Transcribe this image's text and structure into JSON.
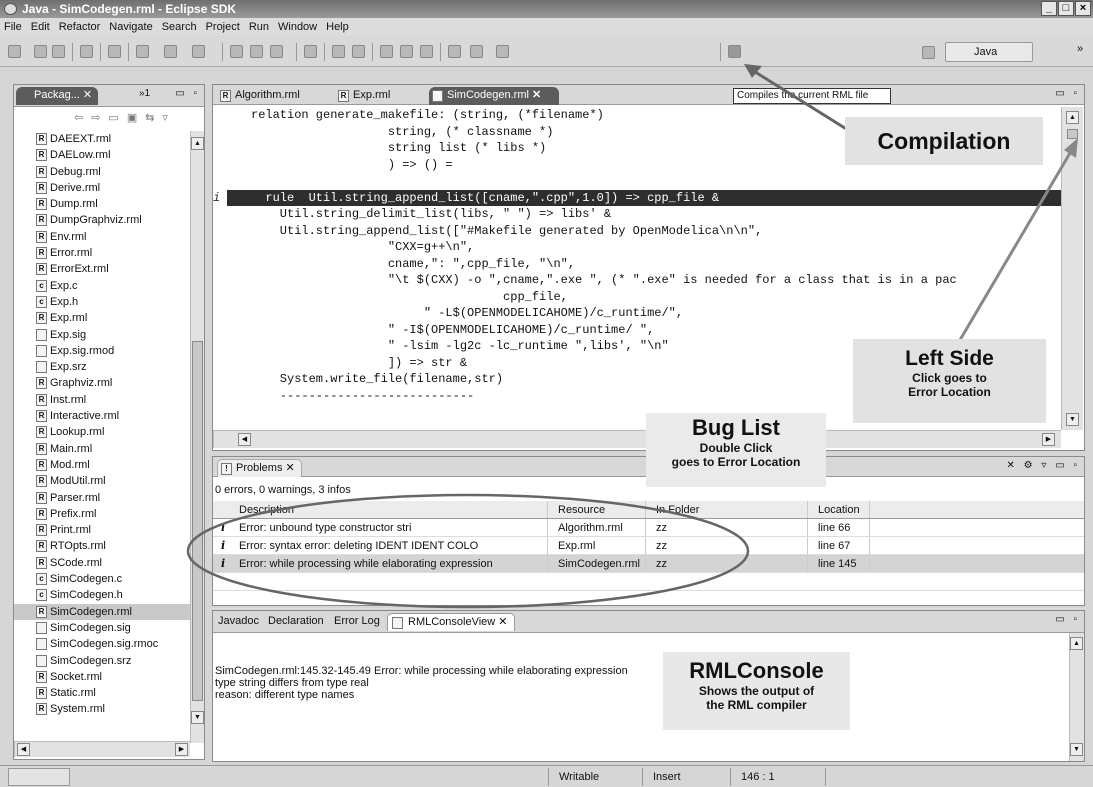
{
  "window": {
    "title": "Java - SimCodegen.rml - Eclipse SDK"
  },
  "menu": [
    "File",
    "Edit",
    "Refactor",
    "Navigate",
    "Search",
    "Project",
    "Run",
    "Window",
    "Help"
  ],
  "toolbar": {
    "perspective": "Java",
    "tooltip": "Compiles the current RML file"
  },
  "package_explorer": {
    "tab_label": "Packag...",
    "tab_overflow": "»1",
    "files": [
      {
        "name": "DAEEXT.rml",
        "type": "R"
      },
      {
        "name": "DAELow.rml",
        "type": "R"
      },
      {
        "name": "Debug.rml",
        "type": "R"
      },
      {
        "name": "Derive.rml",
        "type": "R"
      },
      {
        "name": "Dump.rml",
        "type": "R"
      },
      {
        "name": "DumpGraphviz.rml",
        "type": "R"
      },
      {
        "name": "Env.rml",
        "type": "R"
      },
      {
        "name": "Error.rml",
        "type": "R"
      },
      {
        "name": "ErrorExt.rml",
        "type": "R"
      },
      {
        "name": "Exp.c",
        "type": "c"
      },
      {
        "name": "Exp.h",
        "type": "c"
      },
      {
        "name": "Exp.rml",
        "type": "R"
      },
      {
        "name": "Exp.sig",
        "type": "f"
      },
      {
        "name": "Exp.sig.rmod",
        "type": "f"
      },
      {
        "name": "Exp.srz",
        "type": "f"
      },
      {
        "name": "Graphviz.rml",
        "type": "R"
      },
      {
        "name": "Inst.rml",
        "type": "R"
      },
      {
        "name": "Interactive.rml",
        "type": "R"
      },
      {
        "name": "Lookup.rml",
        "type": "R"
      },
      {
        "name": "Main.rml",
        "type": "R"
      },
      {
        "name": "Mod.rml",
        "type": "R"
      },
      {
        "name": "ModUtil.rml",
        "type": "R"
      },
      {
        "name": "Parser.rml",
        "type": "R"
      },
      {
        "name": "Prefix.rml",
        "type": "R"
      },
      {
        "name": "Print.rml",
        "type": "R"
      },
      {
        "name": "RTOpts.rml",
        "type": "R"
      },
      {
        "name": "SCode.rml",
        "type": "R"
      },
      {
        "name": "SimCodegen.c",
        "type": "c"
      },
      {
        "name": "SimCodegen.h",
        "type": "c"
      },
      {
        "name": "SimCodegen.rml",
        "type": "R",
        "selected": true
      },
      {
        "name": "SimCodegen.sig",
        "type": "f"
      },
      {
        "name": "SimCodegen.sig.rmoc",
        "type": "f"
      },
      {
        "name": "SimCodegen.srz",
        "type": "f"
      },
      {
        "name": "Socket.rml",
        "type": "R"
      },
      {
        "name": "Static.rml",
        "type": "R"
      },
      {
        "name": "System.rml",
        "type": "R"
      }
    ]
  },
  "editor": {
    "tabs": [
      {
        "label": "Algorithm.rml"
      },
      {
        "label": "Exp.rml"
      },
      {
        "label": "SimCodegen.rml",
        "active": true
      }
    ],
    "lines": [
      {
        "text": "relation generate_makefile: (string, (*filename*)",
        "marker": ""
      },
      {
        "text": "                   string, (* classname *)",
        "marker": ""
      },
      {
        "text": "                   string list (* libs *)",
        "marker": ""
      },
      {
        "text": "                   ) => () =",
        "marker": ""
      },
      {
        "text": "",
        "marker": ""
      },
      {
        "text": "  rule  Util.string_append_list([cname,\".cpp\",1.0]) => cpp_file &",
        "marker": "i",
        "highlight": true
      },
      {
        "text": "    Util.string_delimit_list(libs, \" \") => libs' &",
        "marker": ""
      },
      {
        "text": "    Util.string_append_list([\"#Makefile generated by OpenModelica\\n\\n\",",
        "marker": ""
      },
      {
        "text": "                   \"CXX=g++\\n\",",
        "marker": ""
      },
      {
        "text": "                   cname,\": \",cpp_file, \"\\n\",",
        "marker": ""
      },
      {
        "text": "                   \"\\t $(CXX) -o \",cname,\".exe \", (* \".exe\" is needed for a class that is in a pac",
        "marker": ""
      },
      {
        "text": "                                   cpp_file,",
        "marker": ""
      },
      {
        "text": "                        \" -L$(OPENMODELICAHOME)/c_runtime/\",",
        "marker": ""
      },
      {
        "text": "                   \" -I$(OPENMODELICAHOME)/c_runtime/ \",",
        "marker": ""
      },
      {
        "text": "                   \" -lsim -lg2c -lc_runtime \",libs', \"\\n\"",
        "marker": ""
      },
      {
        "text": "                   ]) => str &",
        "marker": ""
      },
      {
        "text": "    System.write_file(filename,str)",
        "marker": ""
      },
      {
        "text": "    ---------------------------",
        "marker": ""
      }
    ]
  },
  "problems": {
    "tab_label": "Problems",
    "summary": "0 errors, 0 warnings, 3 infos",
    "columns": [
      "Description",
      "Resource",
      "In Folder",
      "Location"
    ],
    "rows": [
      {
        "description": "Error: unbound type constructor stri",
        "resource": "Algorithm.rml",
        "folder": "zz",
        "location": "line 66"
      },
      {
        "description": "Error: syntax error: deleting  IDENT IDENT COLO",
        "resource": "Exp.rml",
        "folder": "zz",
        "location": "line 67"
      },
      {
        "description": "Error: while processing while elaborating expression",
        "resource": "SimCodegen.rml",
        "folder": "zz",
        "location": "line 145"
      }
    ]
  },
  "console": {
    "tabs": [
      {
        "label": "Javadoc"
      },
      {
        "label": "Declaration"
      },
      {
        "label": "Error Log"
      },
      {
        "label": "RMLConsoleView",
        "active": true
      }
    ],
    "lines": [
      "SimCodegen.rml:145.32-145.49 Error: while processing while elaborating expression",
      "type string differs from type real",
      "reason: different type names"
    ]
  },
  "annotations": {
    "compilation": "Compilation",
    "left_side_title": "Left Side",
    "left_side_sub1": "Click goes to",
    "left_side_sub2": "Error Location",
    "bug_list_title": "Bug List",
    "bug_list_sub1": "Double Click",
    "bug_list_sub2": "goes to Error Location",
    "rmlconsole_title": "RMLConsole",
    "rmlconsole_sub1": "Shows the output of",
    "rmlconsole_sub2": "the RML compiler"
  },
  "status": {
    "writable": "Writable",
    "mode": "Insert",
    "position": "146 : 1"
  }
}
